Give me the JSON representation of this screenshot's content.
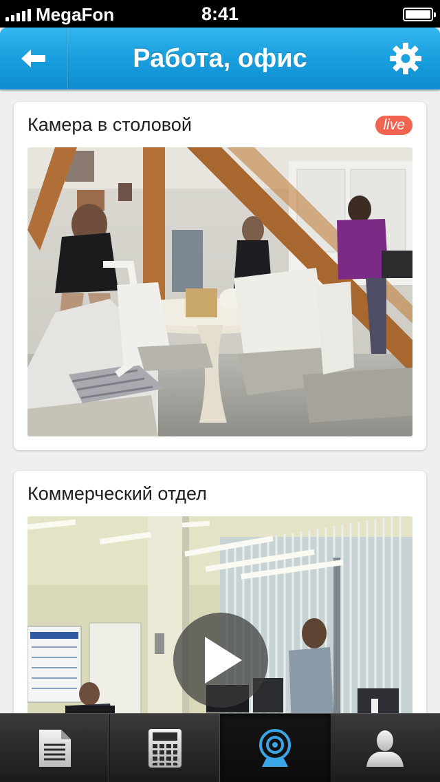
{
  "status_bar": {
    "carrier": "MegaFon",
    "time": "8:41"
  },
  "nav": {
    "title": "Работа, офис",
    "back_icon": "arrow-left-icon",
    "settings_icon": "gear-icon"
  },
  "cameras": [
    {
      "title": "Камера в столовой",
      "badge": "live"
    },
    {
      "title": "Коммерческий отдел",
      "badge": ""
    }
  ],
  "tab_bar": {
    "tabs": [
      {
        "icon": "document-icon",
        "active": false
      },
      {
        "icon": "calculator-icon",
        "active": false
      },
      {
        "icon": "webcam-icon",
        "active": true
      },
      {
        "icon": "user-icon",
        "active": false
      }
    ]
  },
  "colors": {
    "nav_blue": "#1aa1df",
    "live_badge": "#f06450",
    "active_tab_icon": "#3aa6e6",
    "background": "#eeeff1"
  }
}
